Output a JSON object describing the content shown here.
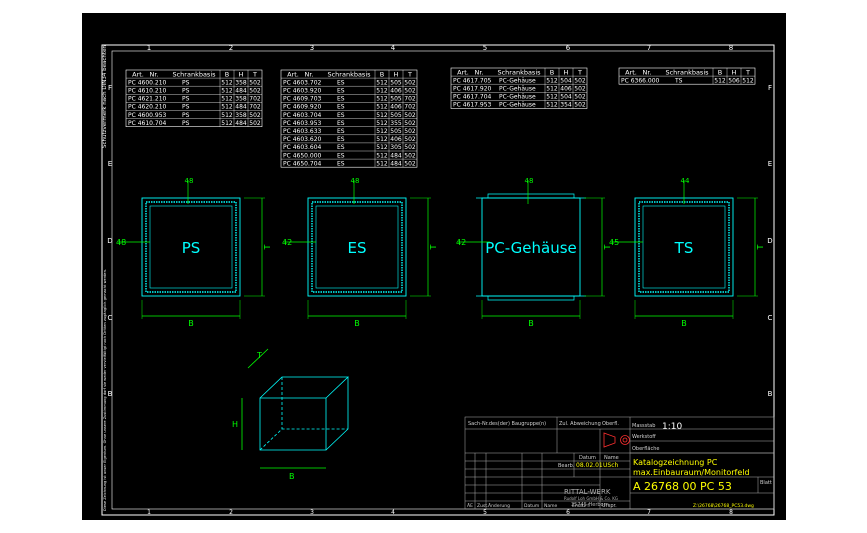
{
  "colors": {
    "background": "#000000",
    "frame": "#ffffff",
    "table_grid": "#ffffff",
    "table_text": "#ffffff",
    "part_outline": "#00ffff",
    "dimension": "#00ff00",
    "part_label": "#00ffff",
    "title_block_text": "#ffff00",
    "title_block_lines": "#b0b0b0"
  },
  "frame": {
    "columns_top": [
      "1",
      "2",
      "3",
      "4",
      "5",
      "6",
      "7",
      "8"
    ],
    "rows_side": [
      "F",
      "E",
      "D",
      "C",
      "B"
    ],
    "side_note": "Schutzvermerk nach DIN34 beachten",
    "left_disclaimer": "Diese Zeichnung ist unser Eigentum. Ohne unsere Zustimmung darf sie weder vervielfältigt noch Dritten zugänglich gemacht werden."
  },
  "tables": [
    {
      "id": "ps",
      "headers": [
        "Art.",
        "Nr.",
        "Schrankbasis",
        "B",
        "H",
        "T"
      ],
      "rows": [
        [
          "PC 4600.210",
          "PS",
          "512",
          "358",
          "502"
        ],
        [
          "PC 4610.210",
          "PS",
          "512",
          "484",
          "502"
        ],
        [
          "PC 4621.210",
          "PS",
          "512",
          "358",
          "702"
        ],
        [
          "PC 4620.210",
          "PS",
          "512",
          "484",
          "702"
        ],
        [
          "PC 4600.953",
          "PS",
          "512",
          "358",
          "502"
        ],
        [
          "PC 4610.704",
          "PS",
          "512",
          "484",
          "502"
        ]
      ]
    },
    {
      "id": "es",
      "headers": [
        "Art.",
        "Nr.",
        "Schrankbasis",
        "B",
        "H",
        "T"
      ],
      "rows": [
        [
          "PC 4603.702",
          "ES",
          "512",
          "505",
          "502"
        ],
        [
          "PC 4603.920",
          "ES",
          "512",
          "406",
          "502"
        ],
        [
          "PC 4609.703",
          "ES",
          "512",
          "505",
          "702"
        ],
        [
          "PC 4609.920",
          "ES",
          "512",
          "406",
          "702"
        ],
        [
          "PC 4603.704",
          "ES",
          "512",
          "505",
          "502"
        ],
        [
          "PC 4603.953",
          "ES",
          "512",
          "355",
          "502"
        ],
        [
          "PC 4603.633",
          "ES",
          "512",
          "505",
          "502"
        ],
        [
          "PC 4603.620",
          "ES",
          "512",
          "406",
          "502"
        ],
        [
          "PC 4603.604",
          "ES",
          "512",
          "305",
          "502"
        ],
        [
          "PC 4650.000",
          "ES",
          "512",
          "484",
          "502"
        ],
        [
          "PC 4650.704",
          "ES",
          "512",
          "484",
          "502"
        ]
      ]
    },
    {
      "id": "pc",
      "headers": [
        "Art.",
        "Nr.",
        "Schrankbasis",
        "B",
        "H",
        "T"
      ],
      "rows": [
        [
          "PC 4617.705",
          "PC-Gehäuse",
          "512",
          "504",
          "502"
        ],
        [
          "PC 4617.920",
          "PC-Gehäuse",
          "512",
          "406",
          "502"
        ],
        [
          "PC 4617.704",
          "PC-Gehäuse",
          "512",
          "504",
          "502"
        ],
        [
          "PC 4617.953",
          "PC-Gehäuse",
          "512",
          "354",
          "502"
        ]
      ]
    },
    {
      "id": "ts",
      "headers": [
        "Art.",
        "Nr.",
        "Schrankbasis",
        "B",
        "H",
        "T"
      ],
      "rows": [
        [
          "PC 6366.000",
          "TS",
          "512",
          "506",
          "512"
        ]
      ]
    }
  ],
  "parts": [
    {
      "label": "PS",
      "top_dim": "48",
      "left_dim": "48",
      "bottom_dim": "B",
      "right_dim": "T"
    },
    {
      "label": "ES",
      "top_dim": "48",
      "left_dim": "42",
      "bottom_dim": "B",
      "right_dim": "T"
    },
    {
      "label": "PC-Gehäuse",
      "top_dim": "48",
      "left_dim": "42",
      "bottom_dim": "B",
      "right_dim": "T"
    },
    {
      "label": "TS",
      "top_dim": "44",
      "left_dim": "45",
      "bottom_dim": "B",
      "right_dim": "T"
    }
  ],
  "iso_box": {
    "t_label": "T",
    "h_label": "H",
    "b_label": "B"
  },
  "title_block": {
    "sach_nr": "Sach-Nr.des(der) Baugruppe(n)",
    "zul_abweichung": "Zul. Abweichung",
    "oberfl": "Oberfl.",
    "massstab_label": "Massstab",
    "massstab_value": "1:10",
    "werkstoff": "Werkstoff",
    "oberflaeche": "Oberfläche",
    "datum_header": "Datum",
    "name_header": "Name",
    "bearb_label": "Bearb.",
    "bearb_date": "08.02.01",
    "bearb_name": "USch",
    "title_line1": "Katalogzeichnung PC",
    "title_line2": "max.Einbauraum/Monitorfeld",
    "company": "RITTAL-WERK",
    "company_sub1": "Rudolf Loh GmbH & Co. KG",
    "company_sub2": "35745 Herborn",
    "drawing_no": "A 26768 00 PC 53",
    "blatt": "Blatt",
    "rev_headers": [
      "ÄE",
      "Zust.",
      "Änderung",
      "Datum",
      "Name",
      "Ersatz f."
    ],
    "ursp": "Urspr.",
    "file_path": "Z:\\26768\\26768_PC53.dwg"
  }
}
